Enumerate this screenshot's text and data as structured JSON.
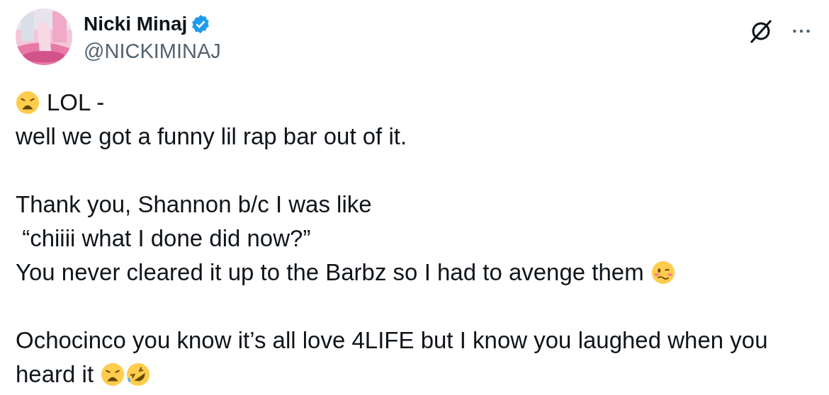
{
  "author": {
    "name": "Nicki Minaj",
    "verified": true,
    "handle": "@NICKIMINAJ"
  },
  "body": [
    [
      {
        "emojis_before": [
          {
            "kind": "weary"
          }
        ],
        "text": "LOL -"
      },
      {
        "text": "well we got a funny lil rap bar out of it."
      }
    ],
    [
      {
        "text": "Thank you, Shannon b/c I was like"
      },
      {
        "text": " “chiiii what I done did now?”"
      },
      {
        "text": "You never cleared it up to the Barbz so I had to avenge them",
        "emojis_after": [
          {
            "kind": "woozy"
          }
        ]
      }
    ],
    [
      {
        "text": "Ochocinco you know it’s all love 4LIFE but I know you laughed when you"
      },
      {
        "text": "heard it",
        "emojis_after": [
          {
            "kind": "weary"
          },
          {
            "kind": "rofl"
          }
        ]
      }
    ]
  ]
}
